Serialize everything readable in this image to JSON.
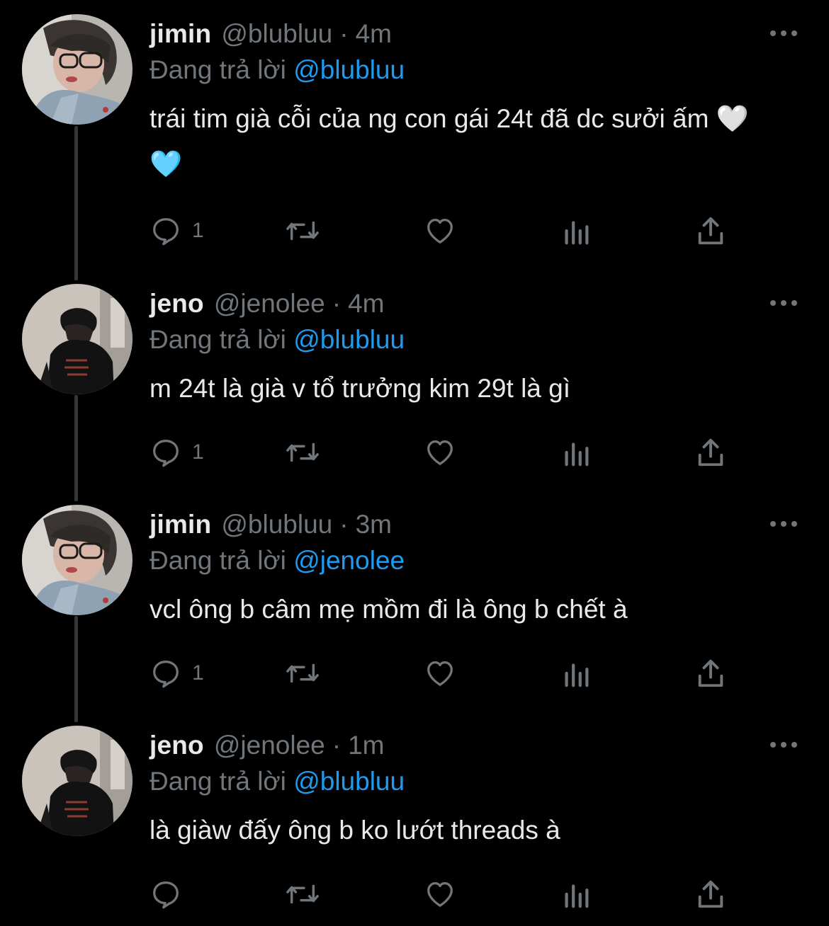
{
  "tweets": [
    {
      "name": "jimin",
      "handle": "@blubluu",
      "dot": "·",
      "time": "4m",
      "reply_prefix": "Đang trả lời",
      "reply_to": "@blubluu",
      "text": "trái tim già cỗi của ng con gái 24t đã dc sưởi ấm 🤍 🩵",
      "reply_count": "1",
      "avatar": "jimin-avatar"
    },
    {
      "name": "jeno",
      "handle": "@jenolee",
      "dot": "·",
      "time": "4m",
      "reply_prefix": "Đang trả lời",
      "reply_to": "@blubluu",
      "text": "m 24t là già v tổ trưởng kim 29t là gì",
      "reply_count": "1",
      "avatar": "jeno-avatar"
    },
    {
      "name": "jimin",
      "handle": "@blubluu",
      "dot": "·",
      "time": "3m",
      "reply_prefix": "Đang trả lời",
      "reply_to": "@jenolee",
      "text": "vcl ông b câm mẹ mồm đi là ông b chết à",
      "reply_count": "1",
      "avatar": "jimin-avatar"
    },
    {
      "name": "jeno",
      "handle": "@jenolee",
      "dot": "·",
      "time": "1m",
      "reply_prefix": "Đang trả lời",
      "reply_to": "@blubluu",
      "text": "là giàw đấy ông b ko lướt threads à",
      "reply_count": "",
      "avatar": "jeno-avatar"
    }
  ],
  "icons": {
    "more": "more-dots-icon",
    "reply": "reply-bubble-icon",
    "retweet": "retweet-icon",
    "like": "heart-icon",
    "views": "views-bar-chart-icon",
    "share": "share-upload-icon"
  },
  "colors": {
    "background": "#000000",
    "text": "#e7e9ea",
    "muted": "#71767b",
    "link": "#1d9bf0",
    "thread_line": "#333639"
  }
}
